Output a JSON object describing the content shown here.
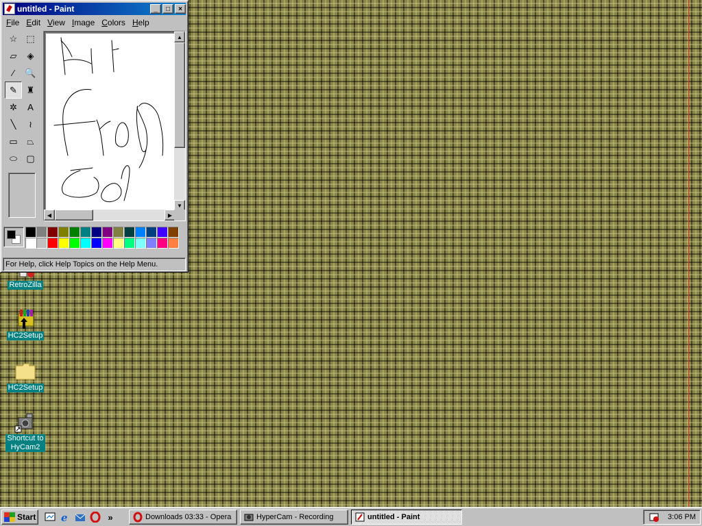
{
  "window": {
    "title": "untitled - Paint",
    "controls": {
      "minimize": "_",
      "maximize": "□",
      "close": "×"
    },
    "menu": [
      "File",
      "Edit",
      "View",
      "Image",
      "Colors",
      "Help"
    ],
    "tools": [
      {
        "name": "free-form-select-icon",
        "glyph": "☆"
      },
      {
        "name": "select-icon",
        "glyph": "⬚"
      },
      {
        "name": "eraser-icon",
        "glyph": "▱"
      },
      {
        "name": "fill-with-color-icon",
        "glyph": "◈"
      },
      {
        "name": "pick-color-icon",
        "glyph": "⁄"
      },
      {
        "name": "magnifier-icon",
        "glyph": "🔍"
      },
      {
        "name": "pencil-icon",
        "glyph": "✎"
      },
      {
        "name": "brush-icon",
        "glyph": "♜"
      },
      {
        "name": "airbrush-icon",
        "glyph": "✲"
      },
      {
        "name": "text-icon",
        "glyph": "A"
      },
      {
        "name": "line-icon",
        "glyph": "╲"
      },
      {
        "name": "curve-icon",
        "glyph": "≀"
      },
      {
        "name": "rectangle-icon",
        "glyph": "▭"
      },
      {
        "name": "polygon-icon",
        "glyph": "⏢"
      },
      {
        "name": "ellipse-icon",
        "glyph": "⬭"
      },
      {
        "name": "rounded-rectangle-icon",
        "glyph": "▢"
      }
    ],
    "active_tool": "pencil-icon",
    "palette": {
      "foreground": "#000000",
      "background": "#ffffff",
      "colors": [
        "#000000",
        "#808080",
        "#800000",
        "#808000",
        "#008000",
        "#008080",
        "#000080",
        "#800080",
        "#808040",
        "#004040",
        "#0080ff",
        "#004080",
        "#4000ff",
        "#804000",
        "#ffffff",
        "#c0c0c0",
        "#ff0000",
        "#ffff00",
        "#00ff00",
        "#00ffff",
        "#0000ff",
        "#ff00ff",
        "#ffff80",
        "#00ff80",
        "#80ffff",
        "#8080ff",
        "#ff0080",
        "#ff8040"
      ]
    },
    "status": "For Help, click Help Topics on the Help Menu."
  },
  "desktop": {
    "icons": [
      {
        "label": "RetroZilla",
        "icon": "retrozilla-icon"
      },
      {
        "label": "HC2Setup",
        "icon": "installer-icon"
      },
      {
        "label": "HC2Setup",
        "icon": "folder-icon"
      },
      {
        "label": "Shortcut to HyCam2",
        "icon": "camera-shortcut-icon"
      }
    ]
  },
  "taskbar": {
    "start_label": "Start",
    "quick_launch": [
      "show-desktop-icon",
      "internet-explorer-icon",
      "outlook-express-icon",
      "opera-icon"
    ],
    "more": "»",
    "tasks": [
      {
        "label": "Downloads 03:33 - Opera",
        "icon": "opera-icon",
        "active": false
      },
      {
        "label": "HyperCam - Recording",
        "icon": "hypercam-icon",
        "active": false
      },
      {
        "label": "untitled - Paint",
        "icon": "paint-icon",
        "active": true
      }
    ],
    "clock": "3:06 PM"
  }
}
